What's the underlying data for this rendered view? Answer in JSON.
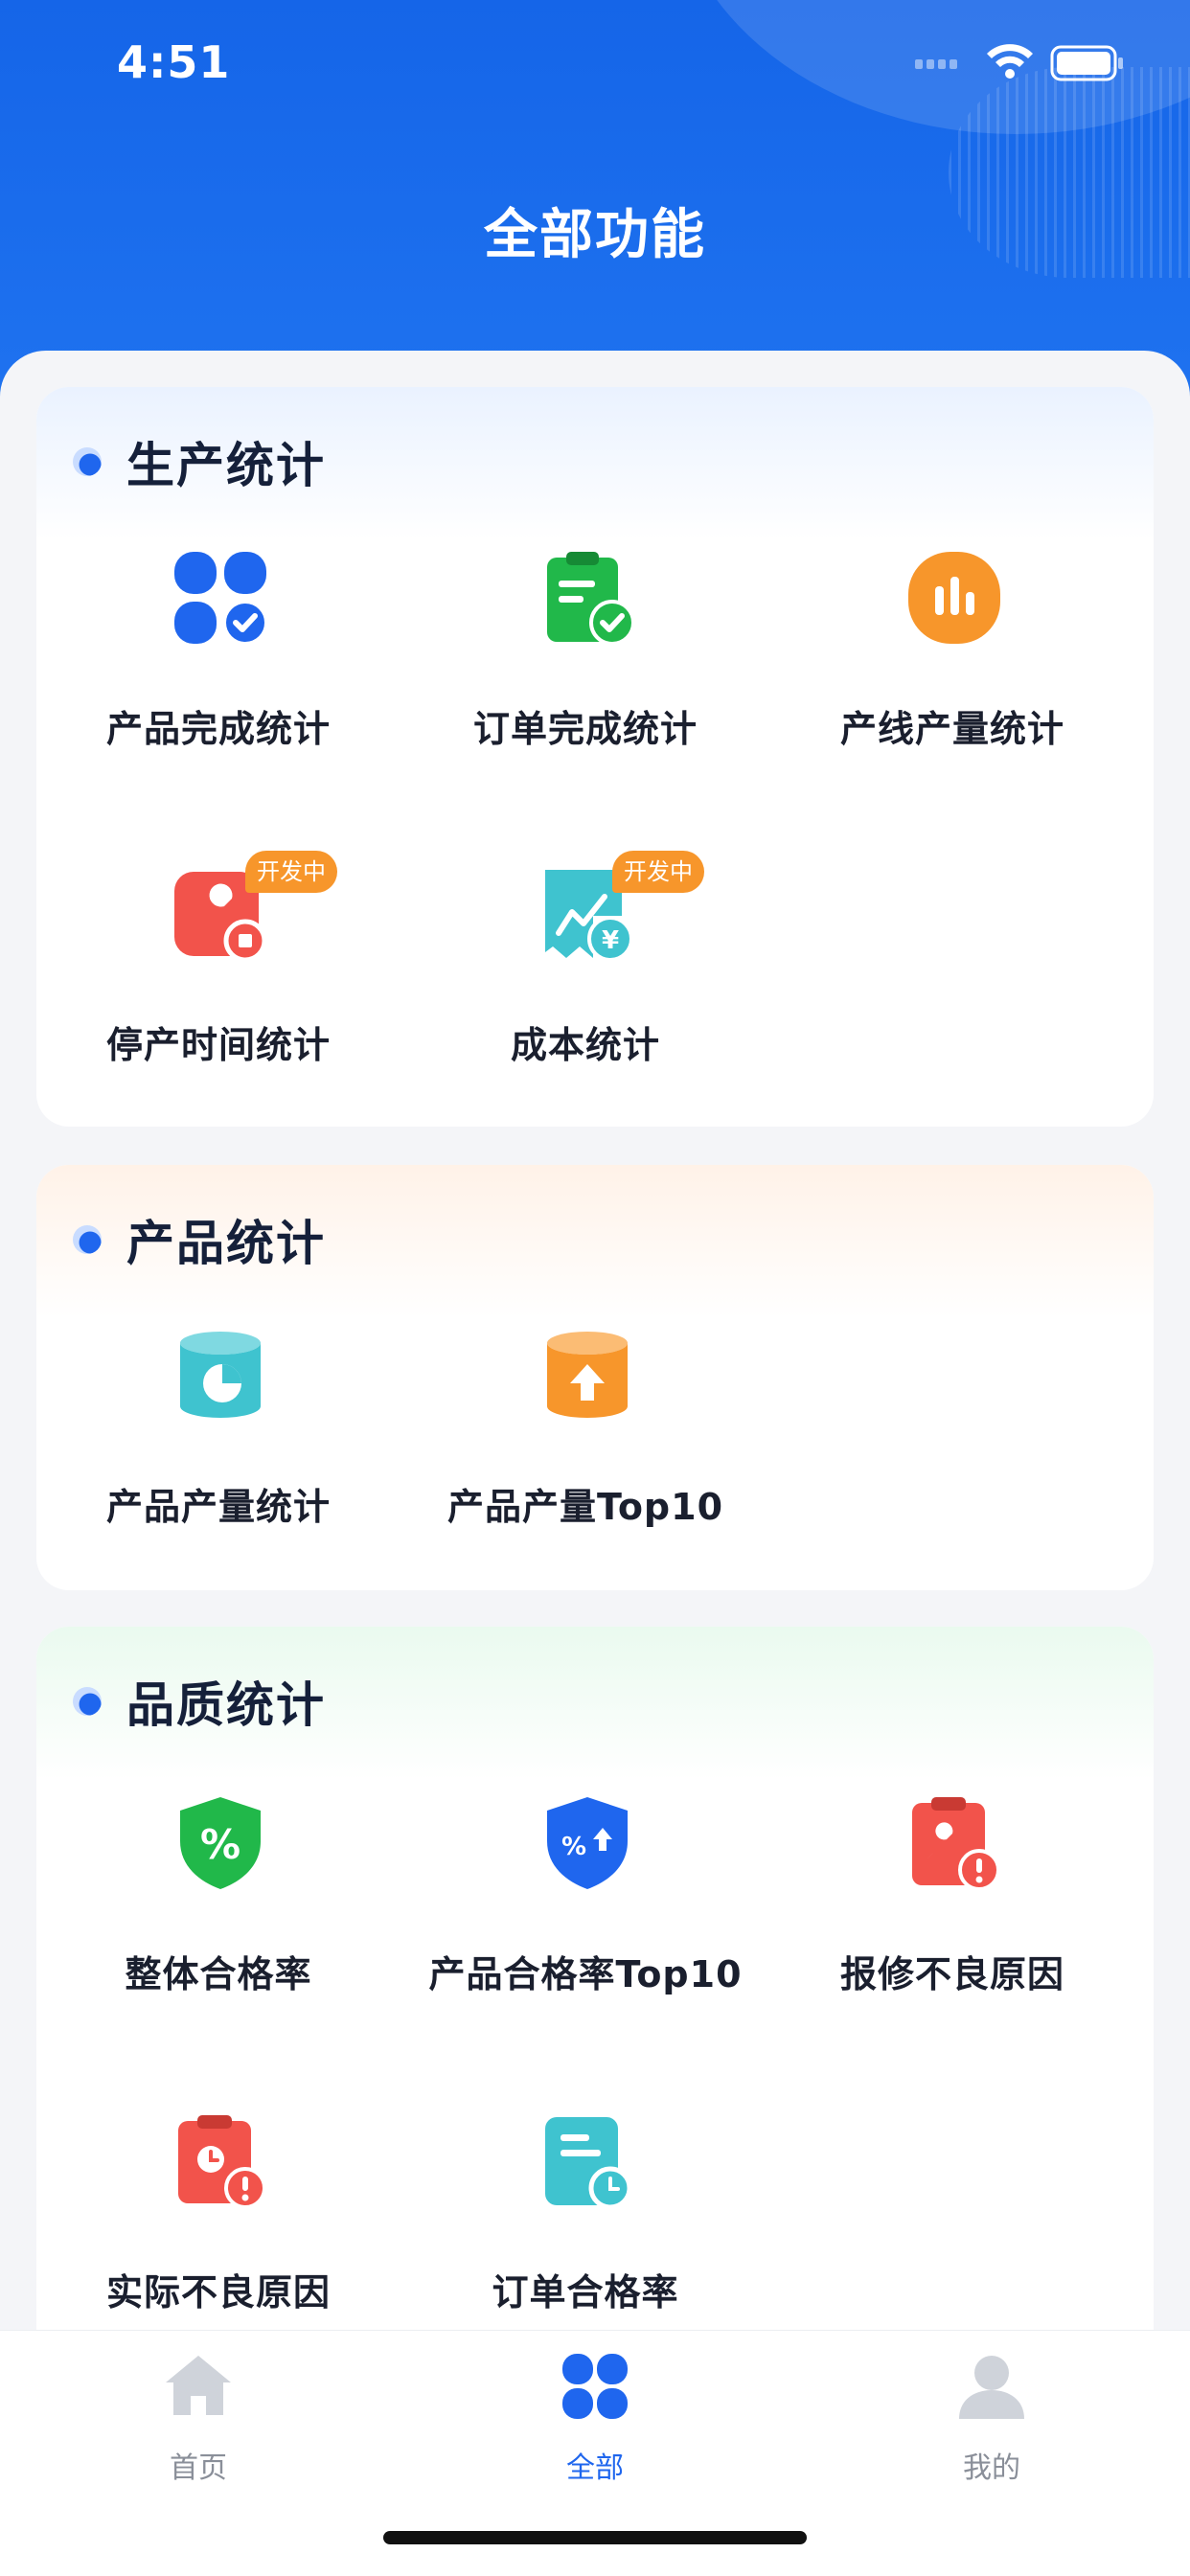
{
  "status_bar": {
    "time": "4:51"
  },
  "page_title": "全部功能",
  "sections": [
    {
      "title": "生产统计",
      "items": [
        {
          "label": "产品完成统计",
          "icon": "product-completion-icon",
          "color": "#1f66ee"
        },
        {
          "label": "订单完成统计",
          "icon": "order-completion-icon",
          "color": "#21b84a"
        },
        {
          "label": "产线产量统计",
          "icon": "line-output-icon",
          "color": "#f7962b"
        },
        {
          "label": "停产时间统计",
          "icon": "downtime-icon",
          "color": "#f2534b",
          "badge": "开发中"
        },
        {
          "label": "成本统计",
          "icon": "cost-icon",
          "color": "#3fc3cf",
          "badge": "开发中"
        }
      ]
    },
    {
      "title": "产品统计",
      "items": [
        {
          "label": "产品产量统计",
          "icon": "product-output-icon",
          "color": "#3fc3cf"
        },
        {
          "label": "产品产量Top10",
          "icon": "product-output-top10-icon",
          "color": "#f7962b"
        }
      ]
    },
    {
      "title": "品质统计",
      "items": [
        {
          "label": "整体合格率",
          "icon": "overall-pass-rate-icon",
          "color": "#21b84a"
        },
        {
          "label": "产品合格率Top10",
          "icon": "product-pass-rate-top10-icon",
          "color": "#1f66ee"
        },
        {
          "label": "报修不良原因",
          "icon": "repair-defect-icon",
          "color": "#f2534b"
        },
        {
          "label": "实际不良原因",
          "icon": "actual-defect-icon",
          "color": "#f2534b"
        },
        {
          "label": "订单合格率",
          "icon": "order-pass-rate-icon",
          "color": "#3fc3cf"
        }
      ]
    }
  ],
  "tabbar": {
    "active": "全部",
    "tabs": [
      {
        "label": "首页",
        "icon": "home-icon"
      },
      {
        "label": "全部",
        "icon": "all-apps-icon"
      },
      {
        "label": "我的",
        "icon": "profile-icon"
      }
    ]
  }
}
